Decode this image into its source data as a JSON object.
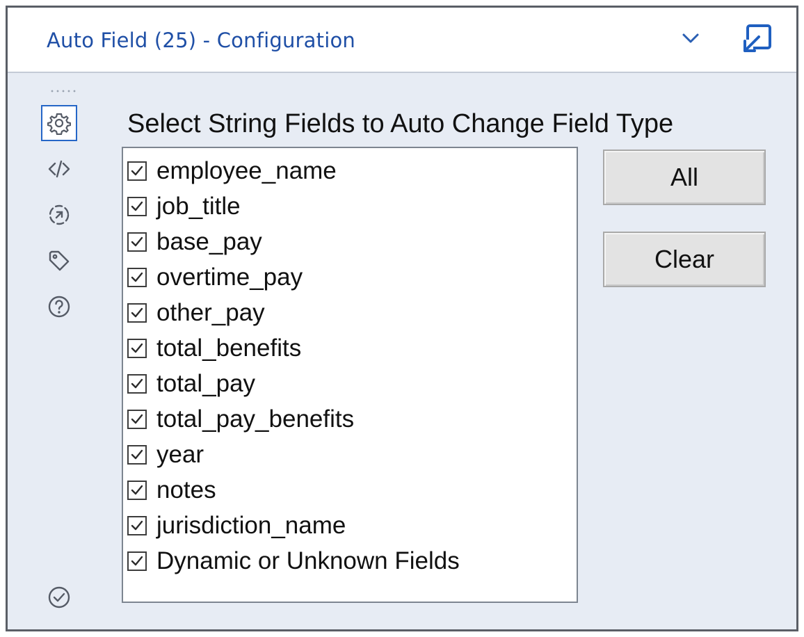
{
  "window": {
    "title": "Auto Field (25) - Configuration"
  },
  "header": {
    "collapse_icon": "chevron-down-icon",
    "popout_icon": "popout-window-icon"
  },
  "sidebar": {
    "items": [
      {
        "icon": "gear-icon",
        "label": "Configuration",
        "active": true
      },
      {
        "icon": "code-icon",
        "label": "XML View",
        "active": false
      },
      {
        "icon": "connection-icon",
        "label": "Connection",
        "active": false
      },
      {
        "icon": "tag-icon",
        "label": "Annotation",
        "active": false
      },
      {
        "icon": "help-icon",
        "label": "Help",
        "active": false
      }
    ],
    "status_icon": "check-circle-icon"
  },
  "config": {
    "heading": "Select String Fields to Auto Change Field Type",
    "fields": [
      {
        "label": "employee_name",
        "checked": true
      },
      {
        "label": "job_title",
        "checked": true
      },
      {
        "label": "base_pay",
        "checked": true
      },
      {
        "label": "overtime_pay",
        "checked": true
      },
      {
        "label": "other_pay",
        "checked": true
      },
      {
        "label": "total_benefits",
        "checked": true
      },
      {
        "label": "total_pay",
        "checked": true
      },
      {
        "label": "total_pay_benefits",
        "checked": true
      },
      {
        "label": "year",
        "checked": true
      },
      {
        "label": "notes",
        "checked": true
      },
      {
        "label": "jurisdiction_name",
        "checked": true
      },
      {
        "label": "Dynamic or Unknown Fields",
        "checked": true
      }
    ],
    "all_button": "All",
    "clear_button": "Clear"
  },
  "colors": {
    "accent": "#2566c7",
    "title_text": "#1f4fa6",
    "panel_bg": "#e7ecf4"
  }
}
